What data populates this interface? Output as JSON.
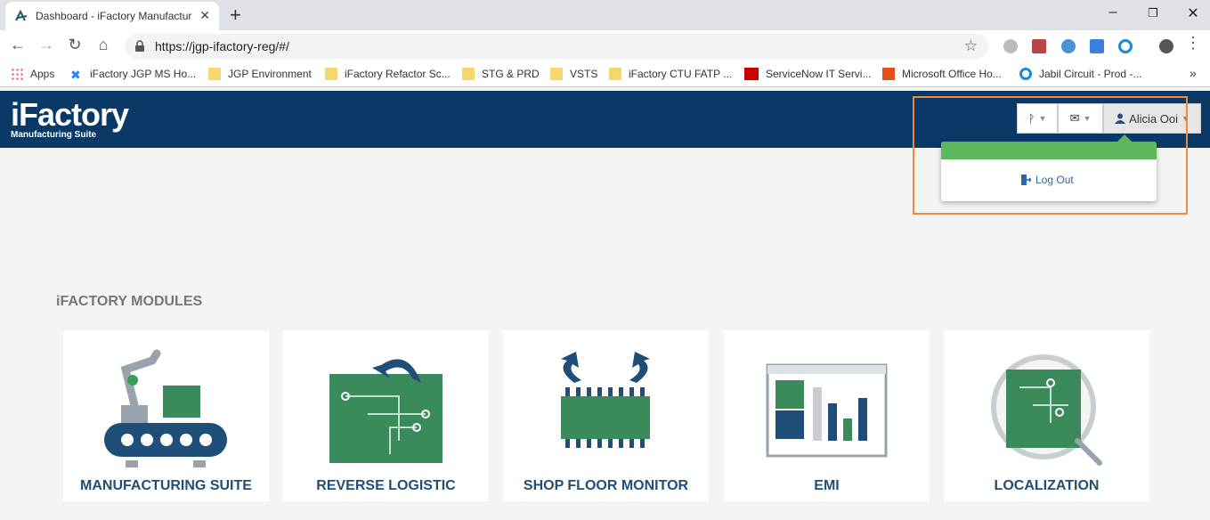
{
  "browser": {
    "tab_title": "Dashboard - iFactory Manufactur",
    "url": "https://jgp-ifactory-reg/#/"
  },
  "bookmarks": [
    {
      "label": "Apps",
      "icon": "apps-grid-icon"
    },
    {
      "label": "iFactory JGP MS Ho...",
      "icon": "confluence-icon"
    },
    {
      "label": "JGP Environment",
      "icon": "folder-icon"
    },
    {
      "label": "iFactory Refactor Sc...",
      "icon": "folder-icon"
    },
    {
      "label": "STG & PRD",
      "icon": "folder-icon"
    },
    {
      "label": "VSTS",
      "icon": "folder-icon"
    },
    {
      "label": "iFactory CTU FATP ...",
      "icon": "folder-icon"
    },
    {
      "label": "ServiceNow IT Servi...",
      "icon": "servicenow-icon"
    },
    {
      "label": "Microsoft Office Ho...",
      "icon": "office-icon"
    },
    {
      "label": "Jabil Circuit - Prod -...",
      "icon": "circle-icon"
    }
  ],
  "header": {
    "logo_main": "iFactory",
    "logo_sub": "Manufacturing Suite",
    "user_name": "Alicia Ooi"
  },
  "dropdown": {
    "logout_label": "Log Out"
  },
  "modules": {
    "title": "iFACTORY MODULES",
    "items": [
      {
        "label": "MANUFACTURING SUITE",
        "icon": "robot-arm-conveyor-icon"
      },
      {
        "label": "REVERSE LOGISTIC",
        "icon": "circuit-board-return-icon"
      },
      {
        "label": "SHOP FLOOR MONITOR",
        "icon": "chip-arrows-icon"
      },
      {
        "label": "EMI",
        "icon": "bar-chart-window-icon"
      },
      {
        "label": "LOCALIZATION",
        "icon": "magnifier-board-icon"
      }
    ]
  },
  "colors": {
    "header_bg": "#0a3967",
    "accent_green": "#5cb85c",
    "highlight_orange": "#f0883e",
    "module_label": "#1f4e79"
  }
}
